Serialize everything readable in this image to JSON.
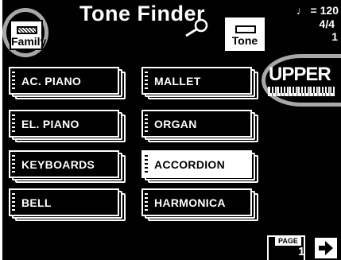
{
  "header": {
    "title": "Tone Finder",
    "family_button_label": "Family",
    "tone_button_label": "Tone",
    "tempo_symbol": "♩ = 120",
    "time_signature": "4/4",
    "measure": "1"
  },
  "part": {
    "label": "UPPER"
  },
  "categories": [
    {
      "label": "AC. PIANO",
      "selected": false
    },
    {
      "label": "EL. PIANO",
      "selected": false
    },
    {
      "label": "KEYBOARDS",
      "selected": false
    },
    {
      "label": "BELL",
      "selected": false
    },
    {
      "label": "MALLET",
      "selected": false
    },
    {
      "label": "ORGAN",
      "selected": false
    },
    {
      "label": "ACCORDION",
      "selected": true
    },
    {
      "label": "HARMONICA",
      "selected": false
    }
  ],
  "pager": {
    "label": "PAGE",
    "current": "1"
  },
  "icons": {
    "search": "magnifier-icon",
    "keyboard": "keyboard-icon",
    "next": "arrow-right-icon"
  }
}
